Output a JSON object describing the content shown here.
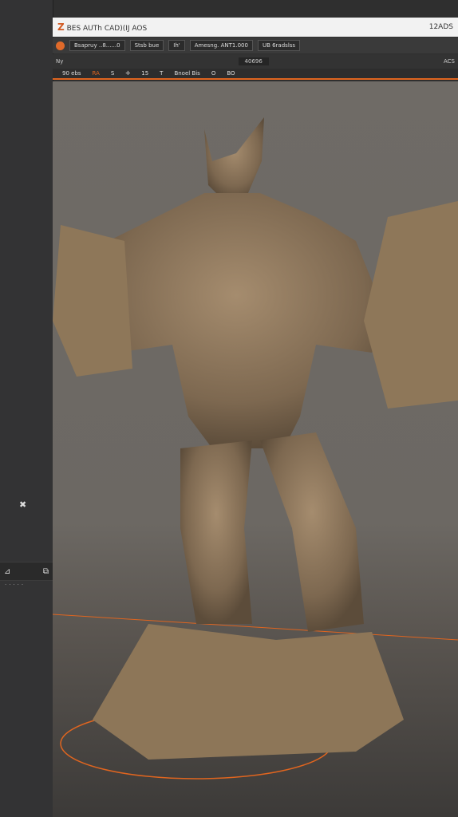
{
  "titlebar": {
    "brand_letter": "Z",
    "title": "BES AUTh  CAD)(IJ AOS",
    "right": "12ADS"
  },
  "toolbar1": {
    "btn1": "Bsapruy ..8......0",
    "btn2": "Stsb bue",
    "btn3": "Ih'",
    "btn4": "Amesng. ANT1.000",
    "btn5": "UB 6radslss"
  },
  "toolbar2": {
    "left": "Ny",
    "zoom": "40696",
    "right": "ACS"
  },
  "toolbar3": {
    "items": [
      "90 ebs",
      "RA",
      "S",
      "✛",
      "15",
      "T",
      "Bnoel Bis",
      "O",
      "BO"
    ]
  }
}
